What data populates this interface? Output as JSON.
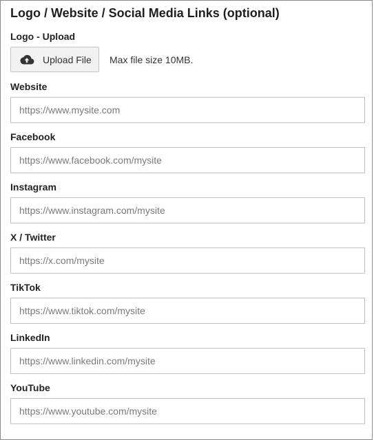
{
  "section": {
    "title": "Logo / Website / Social Media Links (optional)"
  },
  "logo": {
    "label": "Logo - Upload",
    "upload_button_label": "Upload File",
    "upload_icon": "cloud-upload-icon",
    "max_size_text": "Max file size 10MB."
  },
  "fields": [
    {
      "label": "Website",
      "value": "",
      "placeholder": "https://www.mysite.com"
    },
    {
      "label": "Facebook",
      "value": "",
      "placeholder": "https://www.facebook.com/mysite"
    },
    {
      "label": "Instagram",
      "value": "",
      "placeholder": "https://www.instagram.com/mysite"
    },
    {
      "label": "X / Twitter",
      "value": "",
      "placeholder": "https://x.com/mysite"
    },
    {
      "label": "TikTok",
      "value": "",
      "placeholder": "https://www.tiktok.com/mysite"
    },
    {
      "label": "LinkedIn",
      "value": "",
      "placeholder": "https://www.linkedin.com/mysite"
    },
    {
      "label": "YouTube",
      "value": "",
      "placeholder": "https://www.youtube.com/mysite"
    }
  ],
  "colors": {
    "border": "#bdbdbd",
    "button_bg": "#f2f2f2",
    "text": "#222222",
    "placeholder": "#7a7a7a"
  }
}
